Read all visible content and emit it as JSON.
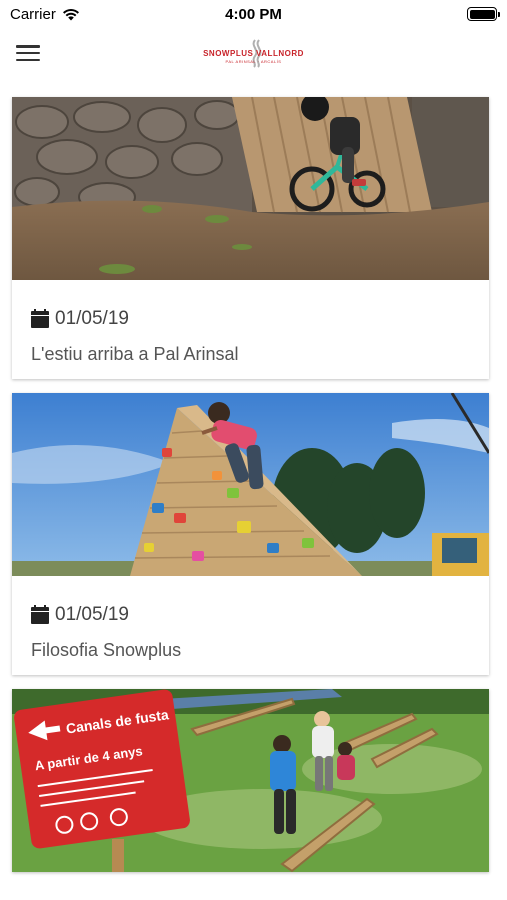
{
  "status_bar": {
    "carrier": "Carrier",
    "time": "4:00 PM",
    "wifi_icon": "wifi-icon",
    "battery_icon": "battery-icon",
    "battery_level": 1.0
  },
  "nav": {
    "menu_icon": "hamburger-menu-icon",
    "logo": {
      "text": "SNOWPLUS VALLNORD",
      "subtext": "PAL ARINSAL · ARCALÍS"
    }
  },
  "feed": {
    "items": [
      {
        "image": "kid-balance-bike-dirt-ramp",
        "date": "01/05/19",
        "title": "L'estiu arriba a Pal Arinsal"
      },
      {
        "image": "girl-climbing-wooden-pyramid",
        "date": "01/05/19",
        "title": "Filosofia Snowplus"
      },
      {
        "image": "kids-water-channels-sign",
        "sign_title": "Canals de fusta",
        "sign_sub": "A partir de 4 anys"
      }
    ]
  },
  "colors": {
    "brand_red": "#c8242b",
    "text": "#555555",
    "background": "#ffffff"
  }
}
